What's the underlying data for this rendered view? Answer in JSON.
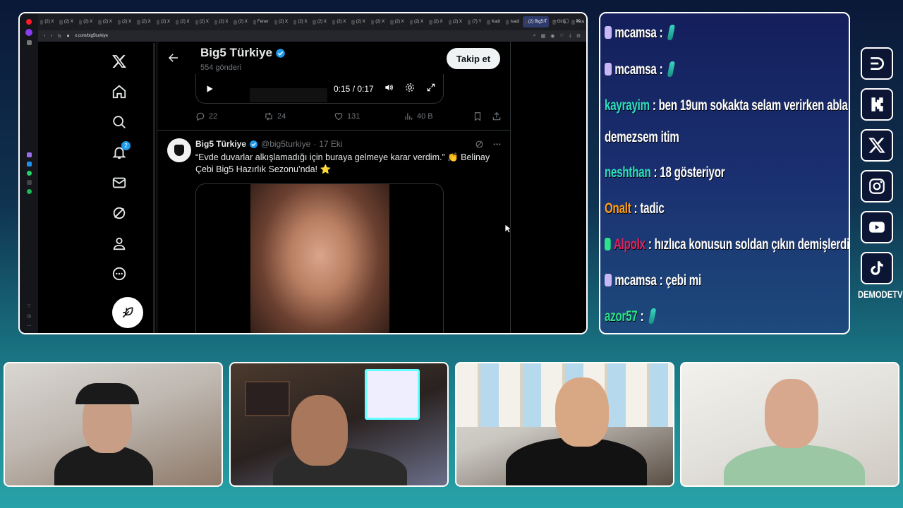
{
  "browser": {
    "tabs": [
      "(2) X",
      "(2) X",
      "(2) X",
      "(2) X",
      "(2) X",
      "(2) X",
      "(2) X",
      "(2) X",
      "(2) X",
      "(2) X",
      "(2) X",
      "Fener",
      "(2) X",
      "(2) X",
      "(2) X",
      "(2) X",
      "(2) X",
      "(2) X",
      "(2) X",
      "(2) X",
      "(2) X",
      "(2) X",
      "(7) Y",
      "Kadi",
      "Isadi",
      "(2) Big5 T",
      "Giriş",
      "kata"
    ],
    "active_tab_index": 25,
    "url": "x.com/big5turkiye"
  },
  "profile": {
    "name": "Big5 Türkiye",
    "post_count": "554 gönderi",
    "follow_label": "Takip et"
  },
  "video1": {
    "time": "0:15 / 0:17"
  },
  "tweet1_actions": {
    "replies": "22",
    "reposts": "24",
    "likes": "131",
    "views": "40 B"
  },
  "nav": {
    "notifications_badge": "2"
  },
  "tweet2": {
    "name": "Big5 Türkiye",
    "handle": "@big5turkiye",
    "separator": "·",
    "date": "17 Eki",
    "text": "“Evde duvarlar alkışlamadığı için buraya gelmeye karar verdim.” 👏 Belinay Çebi Big5 Hazırlık Sezonu’nda! ⭐"
  },
  "chat": {
    "messages": [
      {
        "user": "mcamsa",
        "text": "",
        "user_color": "#ffffff",
        "emote": true,
        "badge": "kick"
      },
      {
        "user": "mcamsa",
        "text": "",
        "user_color": "#ffffff",
        "emote": true,
        "badge": "kick"
      },
      {
        "user": "kayrayim",
        "text": "ben 19um sokakta selam verirken abla",
        "user_color": "#2ee0c0",
        "emote": false,
        "badge": ""
      },
      {
        "user": "",
        "text": "demezsem itim",
        "user_color": "#ffffff",
        "emote": false,
        "badge": ""
      },
      {
        "user": "neshthan",
        "text": "18 gösteriyor",
        "user_color": "#2ee0c0",
        "emote": false,
        "badge": ""
      },
      {
        "user": "Onalt",
        "text": "tadic",
        "user_color": "#ff9d1a",
        "emote": false,
        "badge": ""
      },
      {
        "user": "Alpolx",
        "text": "hızlıca konusun soldan çıkın demişlerdir",
        "user_color": "#e0245e",
        "emote": false,
        "badge": "kick-green"
      },
      {
        "user": "mcamsa",
        "text": "çebi mi",
        "user_color": "#ffffff",
        "emote": false,
        "badge": "kick"
      },
      {
        "user": "azor57",
        "text": "",
        "user_color": "#2de38a",
        "emote": true,
        "badge": ""
      }
    ]
  },
  "socials": [
    "demode-icon",
    "kick-icon",
    "x-icon",
    "instagram-icon",
    "youtube-icon",
    "tiktok-icon"
  ],
  "brand": "DEMODETV",
  "colors": {
    "x_blue": "#1d9bf0",
    "chat_bg": "#141f5c",
    "accent_teal": "#27a3a8"
  }
}
